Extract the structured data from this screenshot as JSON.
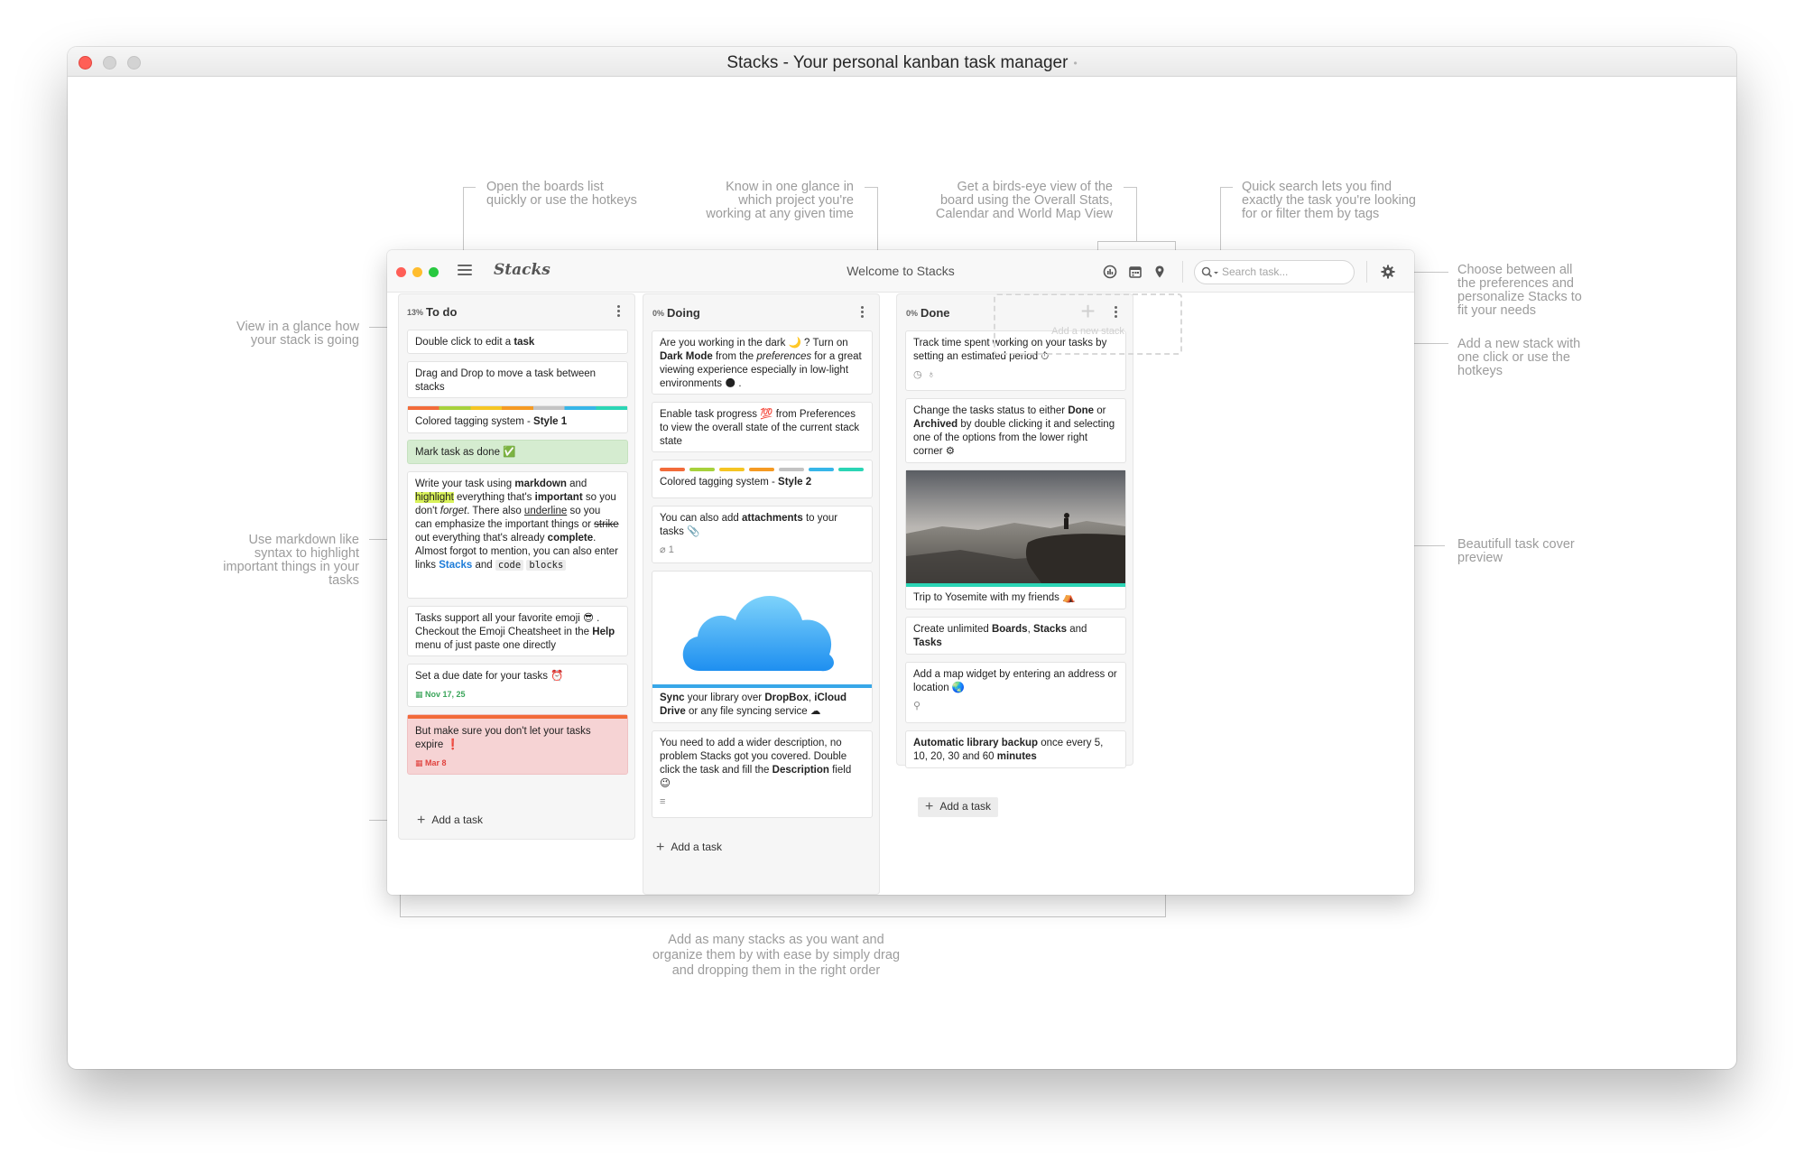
{
  "window": {
    "title": "Stacks - Your personal kanban task manager",
    "title_dot": "•"
  },
  "annotations": {
    "boards": "Open the boards list\nquickly or use the hotkeys",
    "project": "Know in one glance in\nwhich project you're\nworking at any given time",
    "views": "Get a birds-eye view of the\nboard using the Overall Stats,\nCalendar and World Map View",
    "search": "Quick search lets you find\nexactly the task you're looking\nfor or filter them by tags",
    "prefs": "Choose between all\nthe preferences and\npersonalize Stacks to\nfit your needs",
    "add_stack": "Add a new stack with\none click or use the\nhotkeys",
    "progress": "View in a glance how\nyour stack is going",
    "markdown": "Use markdown like\nsyntax to highlight\nimportant things in your\ntasks",
    "cover": "Beautifull task cover\npreview",
    "order": "Add as many stacks as you want and\norganize them by with ease by simply drag\nand dropping them in the right order"
  },
  "app": {
    "logo": "Stacks",
    "title": "Welcome to Stacks",
    "search_placeholder": "Search task...",
    "add_stack_label": "Add a new stack",
    "add_task_label": "Add a task",
    "icons": [
      "menu-icon",
      "stats-icon",
      "calendar-icon",
      "map-pin-icon",
      "search-icon",
      "gear-icon"
    ]
  },
  "stacks": {
    "todo": {
      "pct": "13%",
      "name": "To do",
      "c1": [
        "Double click to edit a ",
        "task"
      ],
      "c2": "Drag and Drop to move a task between stacks",
      "c3": [
        "Colored tagging system - ",
        "Style 1"
      ],
      "c4": "Mark task as done ✅",
      "c5": [
        "Write your task using ",
        "markdown",
        " and ",
        "highlight",
        " everything that's ",
        "important",
        " so you don't ",
        "forget",
        ". There also ",
        "underline",
        " so you can emphasize the important things or ",
        "strike",
        " out everything that's already ",
        "complete",
        ". Almost forgot to mention, you can also enter links ",
        "Stacks",
        " and ",
        "code",
        " ",
        "blocks"
      ],
      "c6": [
        "Tasks support all your favorite emoji 😎 . Checkout the Emoji Cheatsheet in the ",
        "Help",
        " menu of just paste one directly"
      ],
      "c7": "Set a due date for your tasks ⏰",
      "c7_due": "Nov 17, 25",
      "c8": "But make sure you don't let your tasks expire ❗",
      "c8_due": "Mar 8"
    },
    "doing": {
      "pct": "0%",
      "name": "Doing",
      "c1": [
        "Are you working in the dark 🌙 ? Turn on ",
        "Dark Mode",
        " from the ",
        "preferences",
        " for a great viewing experience especially in low-light environments 🌑 ."
      ],
      "c2": "Enable task progress 💯  from Preferences to view the overall state of the current stack state",
      "c3": [
        "Colored tagging system - ",
        "Style 2"
      ],
      "c4": [
        "You can also add ",
        "attachments",
        " to your tasks 📎"
      ],
      "c4_meta": "1",
      "c5": [
        "Sync",
        " your library over ",
        "DropBox",
        ", ",
        "iCloud Drive",
        " or any file syncing service ☁"
      ],
      "c6": [
        "You need to add a wider description, no problem Stacks got you covered. Double click the task and fill the ",
        "Description",
        " field 😉"
      ]
    },
    "done": {
      "pct": "0%",
      "name": "Done",
      "c1": "Track time spent working on your tasks by setting an estimated period ⏱",
      "c2": [
        "Change the tasks status to either ",
        "Done",
        " or ",
        "Archived",
        " by double clicking it and selecting one of the options from the lower right corner ⚙"
      ],
      "c3": "Trip to Yosemite with my friends ⛺",
      "c4": [
        "Create unlimited ",
        "Boards",
        ", ",
        "Stacks",
        " and ",
        "Tasks"
      ],
      "c5": "Add a map widget by entering an address or location 🌏",
      "c6": [
        "Automatic library backup",
        " once every 5, 10, 20, 30 and 60 ",
        "minutes"
      ]
    }
  },
  "colors": {
    "tags": [
      "#f26b3a",
      "#a7d13c",
      "#f5c523",
      "#f59a23",
      "#c3c3c3",
      "#37b6e8",
      "#2bd5b5"
    ],
    "done_card": "#d5ecd0",
    "expired_card": "#f6d3d4",
    "expired_bar": "#f26b3a",
    "due_green": "#3aa55a",
    "due_red": "#e0433f",
    "cloud_bar": "#37a7e8",
    "photo_bar": "#2bd5b5"
  }
}
